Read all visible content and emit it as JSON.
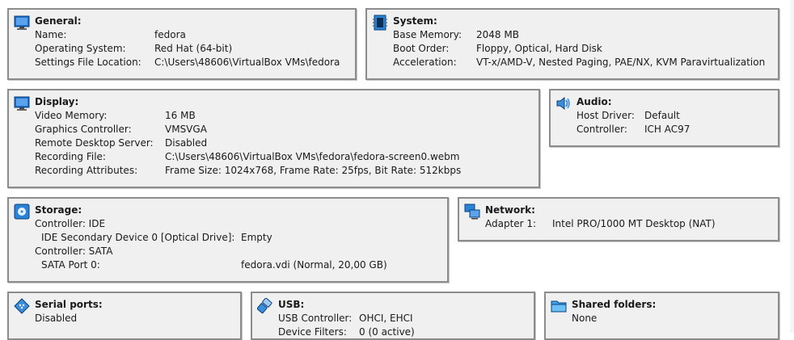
{
  "general": {
    "title": "General:",
    "rows": [
      {
        "label": "Name:",
        "value": "fedora"
      },
      {
        "label": "Operating System:",
        "value": "Red Hat (64-bit)"
      },
      {
        "label": "Settings File Location:",
        "value": "C:\\Users\\48606\\VirtualBox VMs\\fedora"
      }
    ]
  },
  "system": {
    "title": "System:",
    "rows": [
      {
        "label": "Base Memory:",
        "value": "2048 MB"
      },
      {
        "label": "Boot Order:",
        "value": "Floppy, Optical, Hard Disk"
      },
      {
        "label": "Acceleration:",
        "value": "VT-x/AMD-V, Nested Paging, PAE/NX, KVM Paravirtualization"
      }
    ]
  },
  "display": {
    "title": "Display:",
    "rows": [
      {
        "label": "Video Memory:",
        "value": "16 MB"
      },
      {
        "label": "Graphics Controller:",
        "value": "VMSVGA"
      },
      {
        "label": "Remote Desktop Server:",
        "value": "Disabled"
      },
      {
        "label": "Recording File:",
        "value": "C:\\Users\\48606\\VirtualBox VMs\\fedora\\fedora-screen0.webm"
      },
      {
        "label": "Recording Attributes:",
        "value": "Frame Size: 1024x768, Frame Rate: 25fps, Bit Rate: 512kbps"
      }
    ]
  },
  "audio": {
    "title": "Audio:",
    "rows": [
      {
        "label": "Host Driver:",
        "value": "Default"
      },
      {
        "label": "Controller:",
        "value": "ICH AC97"
      }
    ]
  },
  "storage": {
    "title": "Storage:",
    "rows": [
      {
        "label": "Controller: IDE",
        "value": ""
      },
      {
        "label": "IDE Secondary Device 0 [Optical Drive]:",
        "value": "Empty"
      },
      {
        "label": "Controller: SATA",
        "value": ""
      },
      {
        "label": "SATA Port 0:",
        "value": "fedora.vdi (Normal, 20,00 GB)"
      }
    ]
  },
  "network": {
    "title": "Network:",
    "rows": [
      {
        "label": "Adapter 1:",
        "value": "Intel PRO/1000 MT Desktop (NAT)"
      }
    ]
  },
  "serial": {
    "title": "Serial ports:",
    "rows": [
      {
        "label": "Disabled",
        "value": ""
      }
    ]
  },
  "usb": {
    "title": "USB:",
    "rows": [
      {
        "label": "USB Controller:",
        "value": "OHCI, EHCI"
      },
      {
        "label": "Device Filters:",
        "value": "0 (0 active)"
      }
    ]
  },
  "shared": {
    "title": "Shared folders:",
    "rows": [
      {
        "label": "None",
        "value": ""
      }
    ]
  },
  "colors": {
    "panel_bg": "#f0f0f0",
    "panel_border": "#8c8c8c",
    "icon_blue": "#1e6fc8"
  },
  "icons": {
    "general": "monitor-icon",
    "system": "chip-icon",
    "display": "monitor-icon",
    "audio": "speaker-icon",
    "storage": "disk-icon",
    "network": "network-icon",
    "serial": "serial-port-icon",
    "usb": "usb-icon",
    "shared": "folder-icon"
  }
}
